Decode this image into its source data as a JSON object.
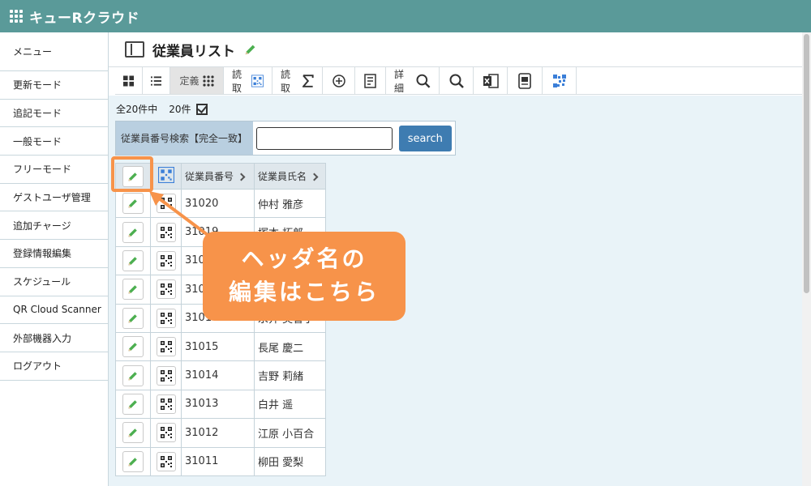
{
  "app": {
    "title": "キューRクラウド"
  },
  "sidebar": {
    "items": [
      {
        "label": "メニュー"
      },
      {
        "label": "更新モード"
      },
      {
        "label": "追記モード"
      },
      {
        "label": "一般モード"
      },
      {
        "label": "フリーモード"
      },
      {
        "label": "ゲストユーザ管理"
      },
      {
        "label": "追加チャージ"
      },
      {
        "label": "登録情報編集"
      },
      {
        "label": "スケジュール"
      },
      {
        "label": "QR Cloud Scanner"
      },
      {
        "label": "外部機器入力"
      },
      {
        "label": "ログアウト"
      }
    ]
  },
  "page": {
    "title": "従業員リスト"
  },
  "toolbar": {
    "teigi": "定義",
    "yomitori1": "読取",
    "yomitori2": "読取",
    "shousai": "詳細"
  },
  "list": {
    "total_text": "全20件中",
    "shown_text": "20件"
  },
  "search": {
    "label": "従業員番号検索【完全一致】",
    "value": "",
    "button": "search"
  },
  "table": {
    "headers": {
      "number": "従業員番号",
      "name": "従業員氏名"
    },
    "rows": [
      {
        "number": "31020",
        "name": "仲村 雅彦"
      },
      {
        "number": "31019",
        "name": "塚本 拓郎"
      },
      {
        "number": "31018",
        "name": ""
      },
      {
        "number": "31017",
        "name": ""
      },
      {
        "number": "31016",
        "name": "永井 美香子"
      },
      {
        "number": "31015",
        "name": "長尾 慶二"
      },
      {
        "number": "31014",
        "name": "吉野 莉緒"
      },
      {
        "number": "31013",
        "name": "白井 遥"
      },
      {
        "number": "31012",
        "name": "江原 小百合"
      },
      {
        "number": "31011",
        "name": "柳田 愛梨"
      }
    ]
  },
  "callout": {
    "line1": "ヘッダ名の",
    "line2": "編集はこちら"
  },
  "colors": {
    "header_bar": "#5a9a99",
    "accent": "#f7934a",
    "search_button": "#3e7cb1",
    "content_bg": "#e9f3f8"
  },
  "icons": [
    "apps-grid-icon",
    "book-icon",
    "pencil-icon",
    "qr-code-icon",
    "sigma-icon",
    "magnifier-icon",
    "excel-icon",
    "document-icon"
  ]
}
